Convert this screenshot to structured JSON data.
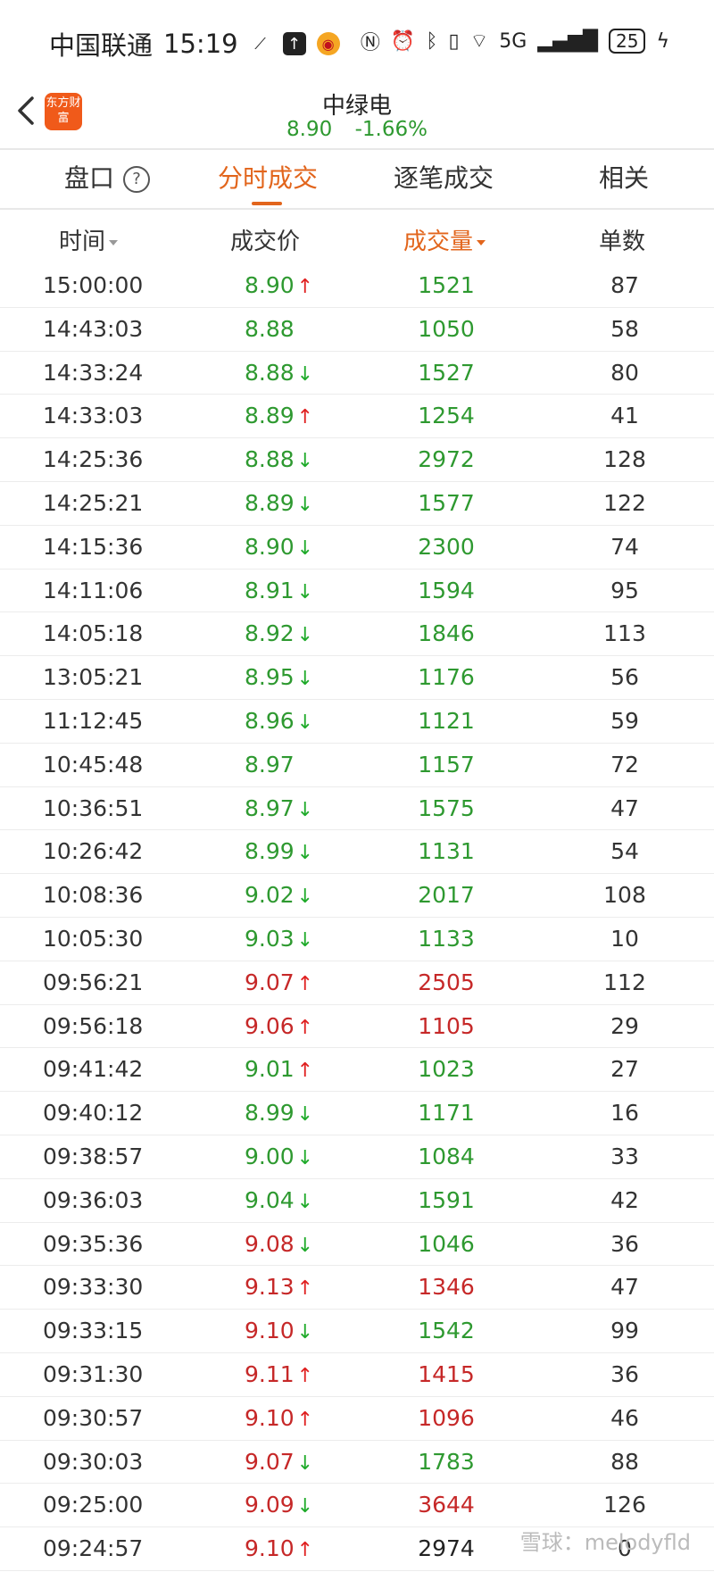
{
  "status_bar": {
    "carrier": "中国联通",
    "time": "15:19",
    "network": "5G",
    "battery": "25"
  },
  "header": {
    "app_logo_text": "东方财富",
    "stock_name": "中绿电",
    "price": "8.90",
    "change_pct": "-1.66%"
  },
  "tabs": [
    {
      "label": "盘口"
    },
    {
      "label": "分时成交"
    },
    {
      "label": "逐笔成交"
    },
    {
      "label": "相关"
    }
  ],
  "active_tab": "分时成交",
  "columns": [
    "时间",
    "成交价",
    "成交量",
    "单数"
  ],
  "rows": [
    {
      "time": "15:00:00",
      "price": "8.90",
      "dir": "up",
      "volume": "1521",
      "count": "87",
      "price_color": "green",
      "vol_color": "green"
    },
    {
      "time": "14:43:03",
      "price": "8.88",
      "dir": "none",
      "volume": "1050",
      "count": "58",
      "price_color": "green",
      "vol_color": "green"
    },
    {
      "time": "14:33:24",
      "price": "8.88",
      "dir": "down",
      "volume": "1527",
      "count": "80",
      "price_color": "green",
      "vol_color": "green"
    },
    {
      "time": "14:33:03",
      "price": "8.89",
      "dir": "up",
      "volume": "1254",
      "count": "41",
      "price_color": "green",
      "vol_color": "green"
    },
    {
      "time": "14:25:36",
      "price": "8.88",
      "dir": "down",
      "volume": "2972",
      "count": "128",
      "price_color": "green",
      "vol_color": "green"
    },
    {
      "time": "14:25:21",
      "price": "8.89",
      "dir": "down",
      "volume": "1577",
      "count": "122",
      "price_color": "green",
      "vol_color": "green"
    },
    {
      "time": "14:15:36",
      "price": "8.90",
      "dir": "down",
      "volume": "2300",
      "count": "74",
      "price_color": "green",
      "vol_color": "green"
    },
    {
      "time": "14:11:06",
      "price": "8.91",
      "dir": "down",
      "volume": "1594",
      "count": "95",
      "price_color": "green",
      "vol_color": "green"
    },
    {
      "time": "14:05:18",
      "price": "8.92",
      "dir": "down",
      "volume": "1846",
      "count": "113",
      "price_color": "green",
      "vol_color": "green"
    },
    {
      "time": "13:05:21",
      "price": "8.95",
      "dir": "down",
      "volume": "1176",
      "count": "56",
      "price_color": "green",
      "vol_color": "green"
    },
    {
      "time": "11:12:45",
      "price": "8.96",
      "dir": "down",
      "volume": "1121",
      "count": "59",
      "price_color": "green",
      "vol_color": "green"
    },
    {
      "time": "10:45:48",
      "price": "8.97",
      "dir": "none",
      "volume": "1157",
      "count": "72",
      "price_color": "green",
      "vol_color": "green"
    },
    {
      "time": "10:36:51",
      "price": "8.97",
      "dir": "down",
      "volume": "1575",
      "count": "47",
      "price_color": "green",
      "vol_color": "green"
    },
    {
      "time": "10:26:42",
      "price": "8.99",
      "dir": "down",
      "volume": "1131",
      "count": "54",
      "price_color": "green",
      "vol_color": "green"
    },
    {
      "time": "10:08:36",
      "price": "9.02",
      "dir": "down",
      "volume": "2017",
      "count": "108",
      "price_color": "green",
      "vol_color": "green"
    },
    {
      "time": "10:05:30",
      "price": "9.03",
      "dir": "down",
      "volume": "1133",
      "count": "10",
      "price_color": "green",
      "vol_color": "green"
    },
    {
      "time": "09:56:21",
      "price": "9.07",
      "dir": "up",
      "volume": "2505",
      "count": "112",
      "price_color": "red",
      "vol_color": "red"
    },
    {
      "time": "09:56:18",
      "price": "9.06",
      "dir": "up",
      "volume": "1105",
      "count": "29",
      "price_color": "red",
      "vol_color": "red"
    },
    {
      "time": "09:41:42",
      "price": "9.01",
      "dir": "up",
      "volume": "1023",
      "count": "27",
      "price_color": "green",
      "vol_color": "green"
    },
    {
      "time": "09:40:12",
      "price": "8.99",
      "dir": "down",
      "volume": "1171",
      "count": "16",
      "price_color": "green",
      "vol_color": "green"
    },
    {
      "time": "09:38:57",
      "price": "9.00",
      "dir": "down",
      "volume": "1084",
      "count": "33",
      "price_color": "green",
      "vol_color": "green"
    },
    {
      "time": "09:36:03",
      "price": "9.04",
      "dir": "down",
      "volume": "1591",
      "count": "42",
      "price_color": "green",
      "vol_color": "green"
    },
    {
      "time": "09:35:36",
      "price": "9.08",
      "dir": "down",
      "volume": "1046",
      "count": "36",
      "price_color": "red",
      "vol_color": "green"
    },
    {
      "time": "09:33:30",
      "price": "9.13",
      "dir": "up",
      "volume": "1346",
      "count": "47",
      "price_color": "red",
      "vol_color": "red"
    },
    {
      "time": "09:33:15",
      "price": "9.10",
      "dir": "down",
      "volume": "1542",
      "count": "99",
      "price_color": "red",
      "vol_color": "green"
    },
    {
      "time": "09:31:30",
      "price": "9.11",
      "dir": "up",
      "volume": "1415",
      "count": "36",
      "price_color": "red",
      "vol_color": "red"
    },
    {
      "time": "09:30:57",
      "price": "9.10",
      "dir": "up",
      "volume": "1096",
      "count": "46",
      "price_color": "red",
      "vol_color": "red"
    },
    {
      "time": "09:30:03",
      "price": "9.07",
      "dir": "down",
      "volume": "1783",
      "count": "88",
      "price_color": "red",
      "vol_color": "green"
    },
    {
      "time": "09:25:00",
      "price": "9.09",
      "dir": "down",
      "volume": "3644",
      "count": "126",
      "price_color": "red",
      "vol_color": "red"
    },
    {
      "time": "09:24:57",
      "price": "9.10",
      "dir": "up",
      "volume": "2974",
      "count": "0",
      "price_color": "red",
      "vol_color": "black"
    }
  ],
  "watermark": "雪球：melodyfld",
  "colors": {
    "accent": "#e2651c",
    "up": "#c62828",
    "down": "#2e9930",
    "logo": "#f05a1a"
  }
}
